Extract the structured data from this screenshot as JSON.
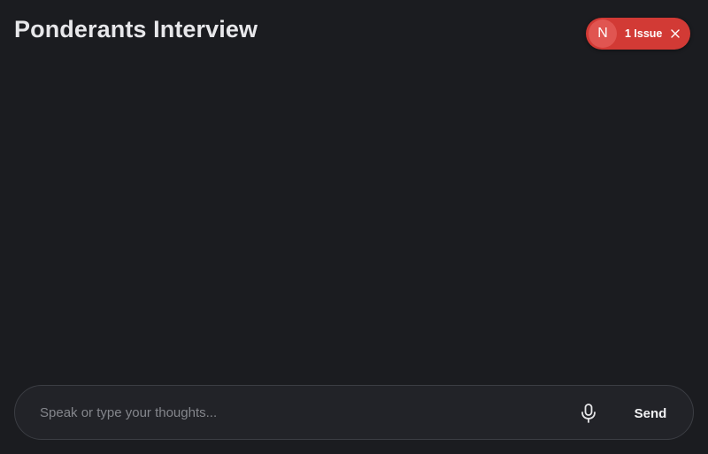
{
  "header": {
    "title": "Ponderants Interview"
  },
  "issue_badge": {
    "avatar_letter": "N",
    "label": "1 Issue",
    "close_icon": "close-icon",
    "color": "#d23a35"
  },
  "composer": {
    "placeholder": "Speak or type your thoughts...",
    "value": "",
    "mic_icon": "microphone-icon",
    "send_label": "Send"
  },
  "colors": {
    "background": "#1b1c20",
    "composer_background": "#222328",
    "composer_border": "#3b3d43"
  }
}
